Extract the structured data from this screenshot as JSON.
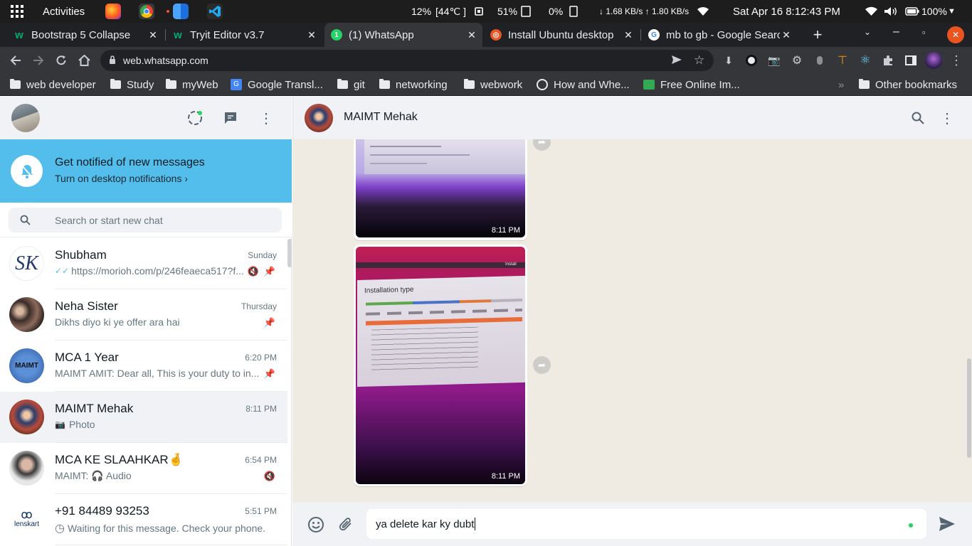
{
  "system": {
    "activities": "Activities",
    "cpu": "12%",
    "temp": "[44℃ ]",
    "mem": "51%",
    "swap": "0%",
    "net": "↓ 1.68 KB/s ↑ 1.80 KB/s",
    "clock": "Sat Apr 16   8:12:43 PM",
    "battery": "100%"
  },
  "tabs": [
    {
      "label": "Bootstrap 5 Collapse",
      "active": false
    },
    {
      "label": "Tryit Editor v3.7",
      "active": false
    },
    {
      "label": "(1) WhatsApp",
      "active": true
    },
    {
      "label": "Install Ubuntu desktop",
      "active": false
    },
    {
      "label": "mb to gb - Google Search",
      "active": false
    }
  ],
  "address": {
    "url": "web.whatsapp.com"
  },
  "bookmarks": [
    {
      "label": "web developer"
    },
    {
      "label": "Study"
    },
    {
      "label": "myWeb"
    },
    {
      "label": "Google Transl..."
    },
    {
      "label": "git"
    },
    {
      "label": "networking"
    },
    {
      "label": "webwork"
    },
    {
      "label": "How and Whe..."
    },
    {
      "label": "Free Online Im..."
    },
    {
      "label": "Other bookmarks"
    }
  ],
  "notification": {
    "title": "Get notified of new messages",
    "subtitle": "Turn on desktop notifications ›"
  },
  "search": {
    "placeholder": "Search or start new chat"
  },
  "chats": [
    {
      "name": "Shubham",
      "time": "Sunday",
      "message": "https://morioh.com/p/246feaeca517?f..."
    },
    {
      "name": "Neha Sister",
      "time": "Thursday",
      "message": "Dikhs diyo ki ye offer ara hai"
    },
    {
      "name": "MCA 1 Year",
      "time": "6:20 PM",
      "message": "MAIMT AMIT: Dear all, This is your duty to in..."
    },
    {
      "name": "MAIMT Mehak",
      "time": "8:11 PM",
      "message": "Photo"
    },
    {
      "name": "MCA KE SLAAHKAR🤞",
      "time": "6:54 PM",
      "message": "MAIMT: 🎧 Audio"
    },
    {
      "name": "+91 84489 93253",
      "time": "5:51 PM",
      "message": "Waiting for this message. Check your phone."
    }
  ],
  "conversation": {
    "name": "MAIMT Mehak",
    "messages": [
      {
        "time": "8:11 PM"
      },
      {
        "time": "8:11 PM",
        "photo_title": "Installation type",
        "photo_corner": "Install"
      }
    ],
    "draft": "ya delete kar ky dubt"
  },
  "colors": {
    "accent": "#53bdeb",
    "green": "#25d366"
  }
}
